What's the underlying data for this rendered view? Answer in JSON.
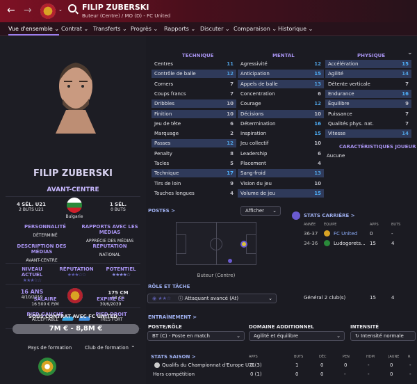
{
  "header": {
    "name": "FILIP ZUBERSKI",
    "subtitle": "Buteur (Centre) / MO (D) - FC United",
    "back_icon": "back-arrow-icon",
    "forward_icon": "forward-arrow-icon",
    "search_icon": "search-icon"
  },
  "tabs": [
    "Vue d'ensemble",
    "Contrat",
    "Transferts",
    "Progrès",
    "Rapports",
    "Discuter",
    "Comparaison",
    "Historique"
  ],
  "left": {
    "name": "FILIP ZUBERSKI",
    "position": "AVANT-CENTRE",
    "caps_left": "4 SÉL. U21",
    "goals_left": "2 BUTS U21",
    "country": "Bulgarie",
    "caps_right": "1 SÉL.",
    "goals_right": "0 BUTS",
    "personality_label": "PERSONNALITÉ",
    "personality": "DÉTERMINÉ",
    "media_label": "RAPPORTS AVEC LES MÉDIAS",
    "media": "APPRÉCIE DES MÉDIAS",
    "desc_label": "DESCRIPTION DES MÉDIAS",
    "desc": "AVANT-CENTRE",
    "rep_label": "RÉPUTATION",
    "rep": "NATIONAL",
    "level_label": "NIVEAU ACTUEL",
    "reput_label": "RÉPUTATION",
    "potential_label": "POTENTIEL",
    "age": "16 ANS",
    "dob": "4/10/2019",
    "height": "175 CM",
    "weight": "68 KG",
    "left_foot_label": "PIED GAUCHE",
    "left_foot": "ACCEPTABLE",
    "right_foot_label": "PIED DROIT",
    "right_foot": "TRÈS FORT",
    "salary_label": "SALAIRE",
    "salary": "16 500 € P/M",
    "expires_label": "EXPIRE LE",
    "expires": "30/6/2039",
    "contract": "SOUS CONTRAT AVEC FC UNITED",
    "value": "7M € - 8,8M €",
    "formation_country": "Pays de formation",
    "formation_club": "Club de formation"
  },
  "attributes": {
    "technique_title": "TECHNIQUE",
    "mental_title": "MENTAL",
    "physique_title": "PHYSIQUE",
    "technique": [
      [
        "Centres",
        "11"
      ],
      [
        "Contrôle de balle",
        "12"
      ],
      [
        "Corners",
        "7"
      ],
      [
        "Coups francs",
        "7"
      ],
      [
        "Dribbles",
        "10"
      ],
      [
        "Finition",
        "10"
      ],
      [
        "Jeu de tête",
        "6"
      ],
      [
        "Marquage",
        "2"
      ],
      [
        "Passes",
        "12"
      ],
      [
        "Penalty",
        "8"
      ],
      [
        "Tacles",
        "5"
      ],
      [
        "Technique",
        "17"
      ],
      [
        "Tirs de loin",
        "9"
      ],
      [
        "Touches longues",
        "4"
      ]
    ],
    "mental": [
      [
        "Agressivité",
        "12"
      ],
      [
        "Anticipation",
        "15"
      ],
      [
        "Appels de balle",
        "13"
      ],
      [
        "Concentration",
        "6"
      ],
      [
        "Courage",
        "12"
      ],
      [
        "Décisions",
        "10"
      ],
      [
        "Détermination",
        "16"
      ],
      [
        "Inspiration",
        "15"
      ],
      [
        "Jeu collectif",
        "10"
      ],
      [
        "Leadership",
        "6"
      ],
      [
        "Placement",
        "4"
      ],
      [
        "Sang-froid",
        "13"
      ],
      [
        "Vision du jeu",
        "10"
      ],
      [
        "Volume de jeu",
        "15"
      ]
    ],
    "physique": [
      [
        "Accélération",
        "15"
      ],
      [
        "Agilité",
        "14"
      ],
      [
        "Détente verticale",
        "7"
      ],
      [
        "Endurance",
        "16"
      ],
      [
        "Équilibre",
        "9"
      ],
      [
        "Puissance",
        "7"
      ],
      [
        "Qualités phys. nat.",
        "7"
      ],
      [
        "Vitesse",
        "14"
      ]
    ],
    "traits_title": "CARACTÉRISTIQUES JOUEUR",
    "traits": "Aucune"
  },
  "positions": {
    "title": "POSTES >",
    "show": "Afficher",
    "caption": "Buteur (Centre)",
    "role_title": "RÔLE ET TÂCHE",
    "role": "Attaquant avancé (At)"
  },
  "career": {
    "title": "STATS CARRIÈRE >",
    "headers": [
      "ANNÉE",
      "ÉQUIPE",
      "APPS",
      "BUTS"
    ],
    "rows": [
      [
        "36-37",
        "FC United",
        "0",
        "-"
      ],
      [
        "34-36",
        "Ludogorets...",
        "15",
        "4"
      ]
    ],
    "total": "Général 2 club(s)",
    "total_apps": "15",
    "total_goals": "4"
  },
  "training": {
    "title": "ENTRAÎNEMENT >",
    "role_label": "POSTE/RÔLE",
    "role": "BT (C) - Poste en match",
    "extra_label": "DOMAINE ADDITIONNEL",
    "extra": "Agilité et équilibre",
    "intensity_label": "INTENSITÉ",
    "intensity": "Intensité normale"
  },
  "season": {
    "title": "STATS SAISON >",
    "headers": [
      "APPS",
      "BUTS",
      "DÉC",
      "PEN",
      "HDM",
      "JAUNE",
      "R"
    ],
    "rows": [
      {
        "label": "Qualifs du Championnat d'Europe U21",
        "vals": [
          "0 (3)",
          "1",
          "0",
          "0",
          "-",
          "0",
          "-"
        ]
      },
      {
        "label": "Hors compétition",
        "vals": [
          "0 (1)",
          "0",
          "0",
          "-",
          "-",
          "0",
          "-"
        ]
      }
    ]
  }
}
